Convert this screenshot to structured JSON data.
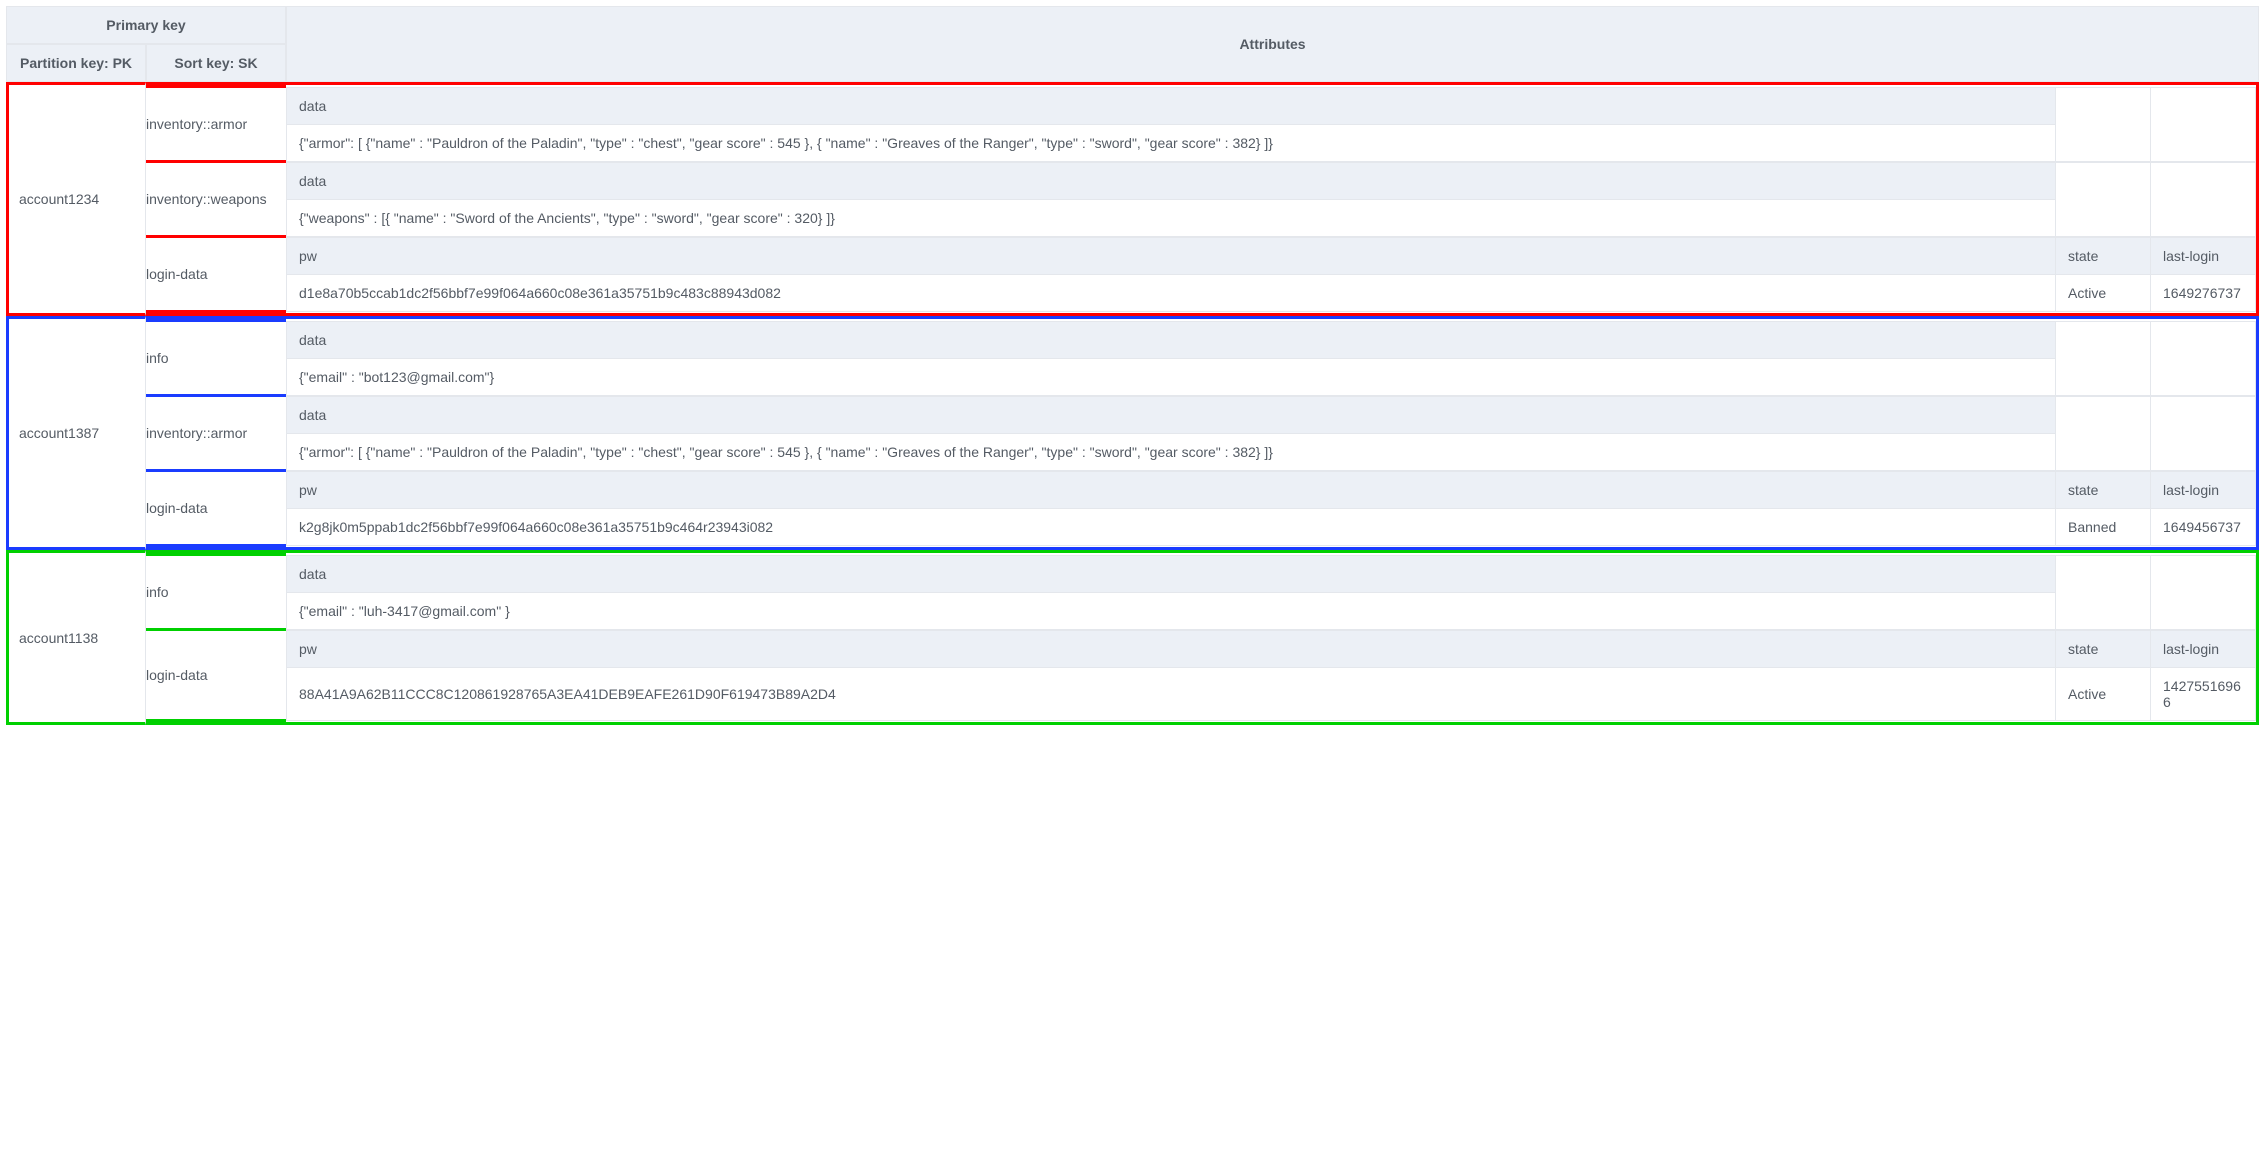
{
  "header": {
    "primary_key": "Primary key",
    "partition_key": "Partition key: PK",
    "sort_key": "Sort key: SK",
    "attributes": "Attributes"
  },
  "labels": {
    "data": "data",
    "pw": "pw",
    "state": "state",
    "last_login": "last-login"
  },
  "groups": [
    {
      "color": "red",
      "pk": "account1234",
      "rows": [
        {
          "sk": "inventory::armor",
          "type": "data",
          "data": "{\"armor\": [ {\"name\" : \"Pauldron of the Paladin\", \"type\" : \"chest\", \"gear score\" : 545 }, { \"name\" : \"Greaves of the Ranger\", \"type\" : \"sword\", \"gear score\" : 382} ]}"
        },
        {
          "sk": "inventory::weapons",
          "type": "data",
          "data": "{\"weapons\" : [{ \"name\" : \"Sword of the Ancients\", \"type\" : \"sword\", \"gear score\" : 320} ]}"
        },
        {
          "sk": "login-data",
          "type": "login",
          "pw": "d1e8a70b5ccab1dc2f56bbf7e99f064a660c08e361a35751b9c483c88943d082",
          "state": "Active",
          "last_login": "1649276737"
        }
      ]
    },
    {
      "color": "blue",
      "pk": "account1387",
      "rows": [
        {
          "sk": "info",
          "type": "data",
          "data": "{\"email\" : \"bot123@gmail.com\"}"
        },
        {
          "sk": "inventory::armor",
          "type": "data",
          "data": "{\"armor\": [ {\"name\" : \"Pauldron of the Paladin\", \"type\" : \"chest\", \"gear score\" : 545 }, { \"name\" : \"Greaves of the Ranger\", \"type\" : \"sword\", \"gear score\" : 382} ]}"
        },
        {
          "sk": "login-data",
          "type": "login",
          "pw": "k2g8jk0m5ppab1dc2f56bbf7e99f064a660c08e361a35751b9c464r23943i082",
          "state": "Banned",
          "last_login": "1649456737"
        }
      ]
    },
    {
      "color": "green",
      "pk": "account1138",
      "rows": [
        {
          "sk": "info",
          "type": "data",
          "data": "{\"email\" : \"luh-3417@gmail.com\" }"
        },
        {
          "sk": "login-data",
          "type": "login",
          "pw": "88A41A9A62B11CCC8C120861928765A3EA41DEB9EAFE261D90F619473B89A2D4",
          "state": "Active",
          "last_login": "14275516966"
        }
      ]
    }
  ]
}
